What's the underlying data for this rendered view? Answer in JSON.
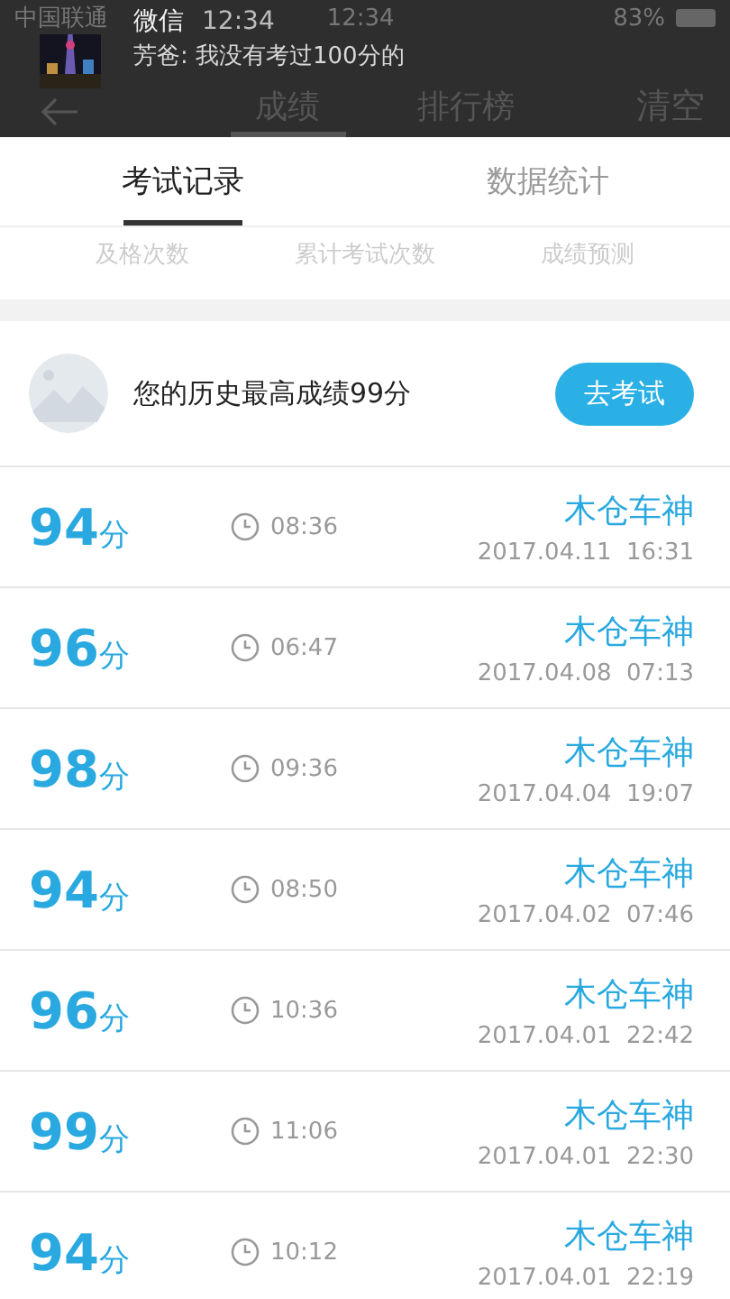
{
  "status_bar": {
    "carrier": "中国联通",
    "time": "12:34",
    "battery": "83%"
  },
  "notification": {
    "app": "微信",
    "time": "12:34",
    "message": "芳爸: 我没有考过100分的"
  },
  "nav": {
    "tabs": [
      {
        "label": "成绩",
        "selected": true
      },
      {
        "label": "排行榜",
        "selected": false
      }
    ],
    "action": "清空"
  },
  "sub_tabs": [
    {
      "label": "考试记录",
      "selected": true
    },
    {
      "label": "数据统计",
      "selected": false
    }
  ],
  "stats_labels": [
    "及格次数",
    "累计考试次数",
    "成绩预测"
  ],
  "best": {
    "text": "您的历史最高成绩99分",
    "button": "去考试"
  },
  "records": [
    {
      "score": "94",
      "unit": "分",
      "duration": "08:36",
      "name": "木仓车神",
      "date": "2017.04.11  16:31"
    },
    {
      "score": "96",
      "unit": "分",
      "duration": "06:47",
      "name": "木仓车神",
      "date": "2017.04.08  07:13"
    },
    {
      "score": "98",
      "unit": "分",
      "duration": "09:36",
      "name": "木仓车神",
      "date": "2017.04.04  19:07"
    },
    {
      "score": "94",
      "unit": "分",
      "duration": "08:50",
      "name": "木仓车神",
      "date": "2017.04.02  07:46"
    },
    {
      "score": "96",
      "unit": "分",
      "duration": "10:36",
      "name": "木仓车神",
      "date": "2017.04.01  22:42"
    },
    {
      "score": "99",
      "unit": "分",
      "duration": "11:06",
      "name": "木仓车神",
      "date": "2017.04.01  22:30"
    },
    {
      "score": "94",
      "unit": "分",
      "duration": "10:12",
      "name": "木仓车神",
      "date": "2017.04.01  22:19"
    }
  ]
}
